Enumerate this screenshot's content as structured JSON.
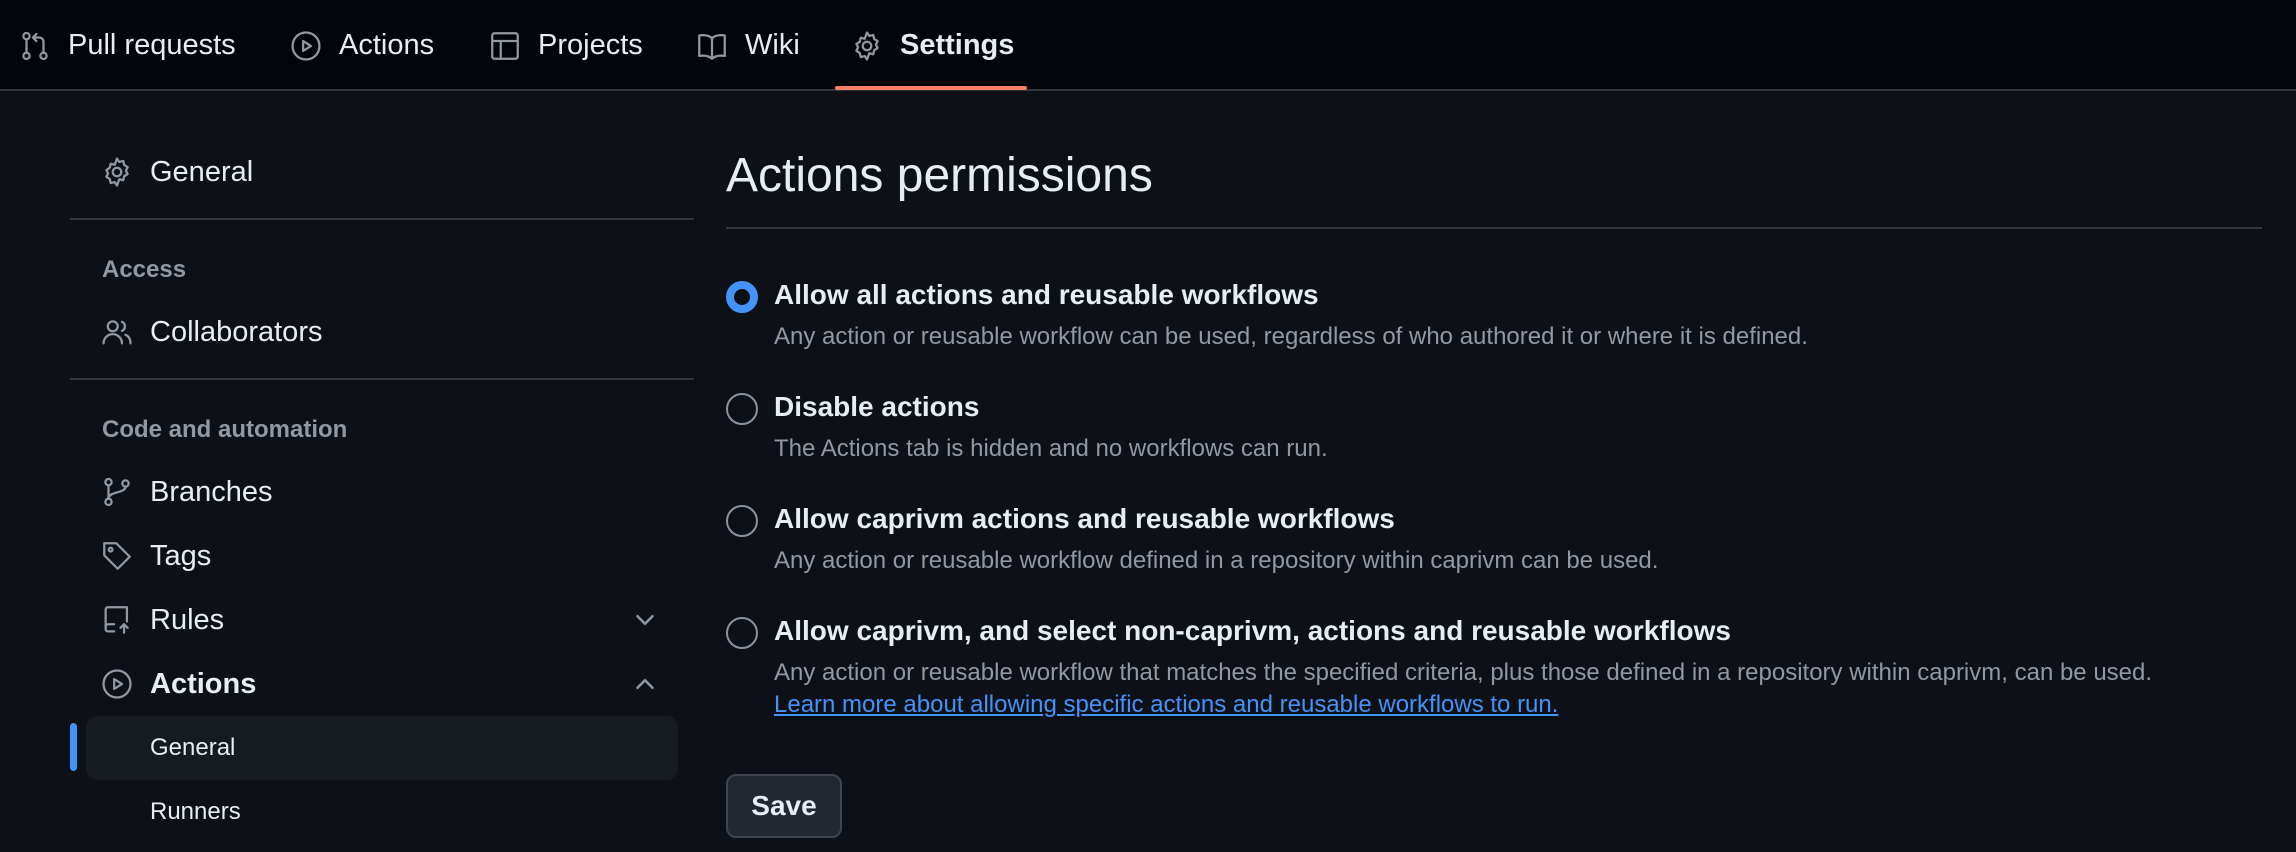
{
  "topnav": {
    "tabs": [
      {
        "label": "Pull requests",
        "icon": "git-pull-request-icon"
      },
      {
        "label": "Actions",
        "icon": "play-icon"
      },
      {
        "label": "Projects",
        "icon": "table-icon"
      },
      {
        "label": "Wiki",
        "icon": "book-icon"
      },
      {
        "label": "Settings",
        "icon": "gear-icon",
        "selected": true
      }
    ]
  },
  "sidebar": {
    "general": "General",
    "access_heading": "Access",
    "collaborators": "Collaborators",
    "code_heading": "Code and automation",
    "branches": "Branches",
    "tags": "Tags",
    "rules": "Rules",
    "actions": "Actions",
    "actions_sub": [
      {
        "label": "General",
        "active": true
      },
      {
        "label": "Runners",
        "active": false
      }
    ]
  },
  "main": {
    "title": "Actions permissions",
    "options": [
      {
        "label": "Allow all actions and reusable workflows",
        "desc": "Any action or reusable workflow can be used, regardless of who authored it or where it is defined.",
        "checked": true
      },
      {
        "label": "Disable actions",
        "desc": "The Actions tab is hidden and no workflows can run.",
        "checked": false
      },
      {
        "label": "Allow caprivm actions and reusable workflows",
        "desc": "Any action or reusable workflow defined in a repository within caprivm can be used.",
        "checked": false
      },
      {
        "label": "Allow caprivm, and select non-caprivm, actions and reusable workflows",
        "desc": "Any action or reusable workflow that matches the specified criteria, plus those defined in a repository within caprivm, can be used.",
        "link": "Learn more about allowing specific actions and reusable workflows to run.",
        "checked": false
      }
    ],
    "save_label": "Save"
  },
  "colors": {
    "background": "#0d1117",
    "topnav_bg": "#010409",
    "accent": "#4493f8",
    "tab_underline": "#f78166",
    "muted_text": "#9198a1"
  }
}
